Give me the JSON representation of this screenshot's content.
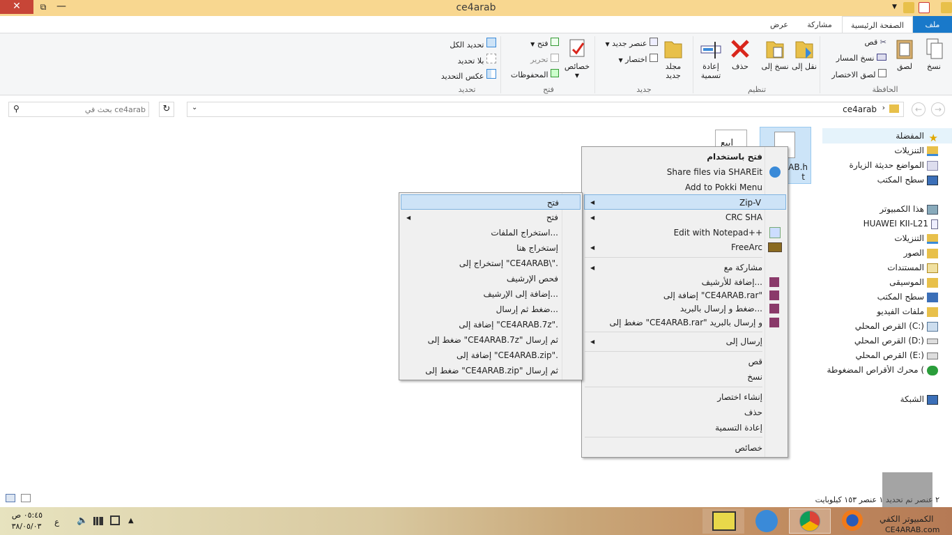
{
  "window": {
    "title": "ce4arab",
    "close": "✕",
    "restore": "⧉",
    "minimize": "—"
  },
  "ribbon_tabs": {
    "file": "ملف",
    "home": "الصفحة الرئيسية",
    "share": "مشاركة",
    "view": "عرض"
  },
  "help": "?",
  "ribbon": {
    "clipboard": {
      "label": "الحافظة",
      "copy": "نسخ",
      "paste": "لصق",
      "cut": "قص",
      "copy_path": "نسخ المسار",
      "paste_shortcut": "لصق الاختصار"
    },
    "organize": {
      "label": "تنظيم",
      "move_to": "نقل إلى",
      "copy_to": "نسخ إلى",
      "delete": "حذف",
      "rename": "إعادة تسمية"
    },
    "new": {
      "label": "جديد",
      "new_folder": "مجلد جديد",
      "new_item": "عنصر جديد",
      "easy_access": "اختصار"
    },
    "open": {
      "label": "فتح",
      "properties": "خصائص",
      "open": "فتح",
      "edit": "تحرير",
      "history": "المحفوظات"
    },
    "select": {
      "label": "تحديد",
      "select_all": "تحديد الكل",
      "select_none": "بلا تحديد",
      "invert": "عكس التحديد"
    }
  },
  "address": {
    "path": "ce4arab",
    "search_placeholder": "بحث في ce4arab"
  },
  "nav_pane": {
    "favorites": "المفضلة",
    "downloads": "التنزيلات",
    "recent": "المواضع حديثة الزيارة",
    "desktop": "سطح المكتب",
    "this_pc": "هذا الكمبيوتر",
    "phone": "HUAWEI KII-L21",
    "pc_downloads": "التنزيلات",
    "pictures": "الصور",
    "documents": "المستندات",
    "music": "الموسيقى",
    "pc_desktop": "سطح المكتب",
    "videos": "ملفات الفيديو",
    "drive_c": "القرص المحلي (C:)",
    "drive_d": "القرص المحلي (D:)",
    "drive_e": "القرص المحلي (E:)",
    "dvd": "محرك الأقراص المضغوطة (",
    "network": "الشبكة"
  },
  "files": {
    "file1_label": "ARAB.h",
    "file1_ext": "t",
    "file2_label": "ابيع"
  },
  "context_menu": {
    "open_with": "فتح باستخدام",
    "shareit": "Share files via SHAREit",
    "pokki": "Add to Pokki Menu",
    "zip7": "Zip-V",
    "crc": "CRC SHA",
    "notepad": "Edit with Notepad++",
    "freearc": "FreeArc",
    "share_with": "مشاركة مع",
    "add_archive": "إضافة للأرشيف...",
    "add_rar": "إضافة إلى \"CE4ARAB.rar\"",
    "compress_email": "ضغط و إرسال بالبريد...",
    "compress_rar_email": "ضغط إلى \"CE4ARAB.rar\" و إرسال بالبريد",
    "send_to": "إرسال إلى",
    "cut": "قص",
    "copy": "نسخ",
    "create_shortcut": "إنشاء اختصار",
    "delete": "حذف",
    "rename": "إعادة التسمية",
    "properties": "خصائص"
  },
  "submenu": {
    "open": "فتح",
    "open_sub": "فتح",
    "extract_files": "استخراج الملفات...",
    "extract_here": "إستخراج هنا",
    "extract_to": "إستخراج إلى \"CE4ARAB\\\".",
    "test": "فحص الإرشيف",
    "add_archive": "إضافة إلى الإرشيف...",
    "compress_send": "ضغط ثم إرسال...",
    "add_7z": "إضافة إلى \"CE4ARAB.7z\".",
    "compress_7z_send": "ضغط إلى \"CE4ARAB.7z\" ثم إرسال",
    "add_zip": "إضافة إلى \"CE4ARAB.zip\".",
    "compress_zip_send": "ضغط إلى \"CE4ARAB.zip\" ثم إرسال"
  },
  "status_bar": {
    "text": "٢ عنصر   تم تحديد ١ عنصر  ١٥٣ كيلوبايت"
  },
  "taskbar": {
    "time": "٠٥:٤٥ ص",
    "date": "٣٨/٠٥/٠٣",
    "lang": "ع",
    "watermark_top": "الكمبيوتر الكفي",
    "watermark_bottom": "CE4ARAB.com"
  }
}
